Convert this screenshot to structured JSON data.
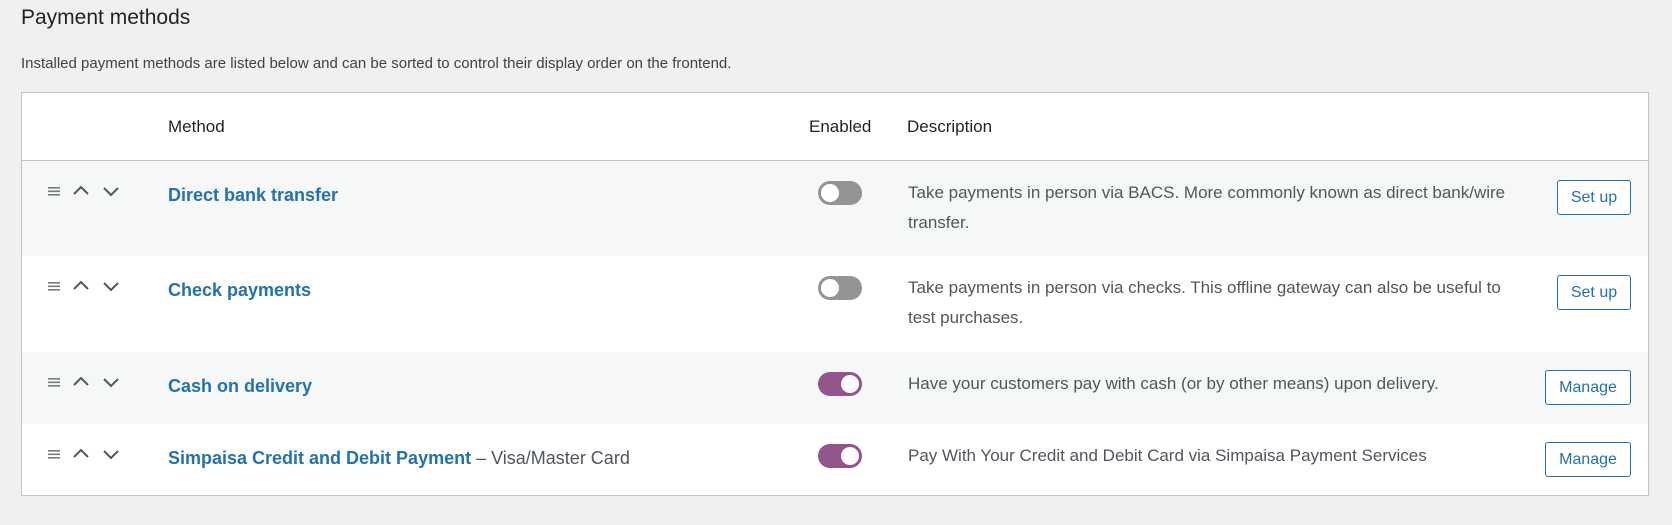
{
  "page": {
    "title": "Payment methods",
    "description": "Installed payment methods are listed below and can be sorted to control their display order on the frontend."
  },
  "table": {
    "headers": {
      "method": "Method",
      "enabled": "Enabled",
      "description": "Description"
    },
    "rows": [
      {
        "name": "Direct bank transfer",
        "suffix": "",
        "enabled": false,
        "description": "Take payments in person via BACS. More commonly known as direct bank/wire transfer.",
        "action": "Set up"
      },
      {
        "name": "Check payments",
        "suffix": "",
        "enabled": false,
        "description": "Take payments in person via checks. This offline gateway can also be useful to test purchases.",
        "action": "Set up"
      },
      {
        "name": "Cash on delivery",
        "suffix": "",
        "enabled": true,
        "description": "Have your customers pay with cash (or by other means) upon delivery.",
        "action": "Manage"
      },
      {
        "name": "Simpaisa Credit and Debit Payment",
        "suffix": " – Visa/Master Card",
        "enabled": true,
        "description": "Pay With Your Credit and Debit Card via Simpaisa Payment Services",
        "action": "Manage"
      }
    ]
  },
  "colors": {
    "link": "#2271b1",
    "toggle_on": "#93568c",
    "toggle_off": "#949494"
  },
  "icons": [
    "drag-handle-icon",
    "move-up-icon",
    "move-down-icon"
  ]
}
